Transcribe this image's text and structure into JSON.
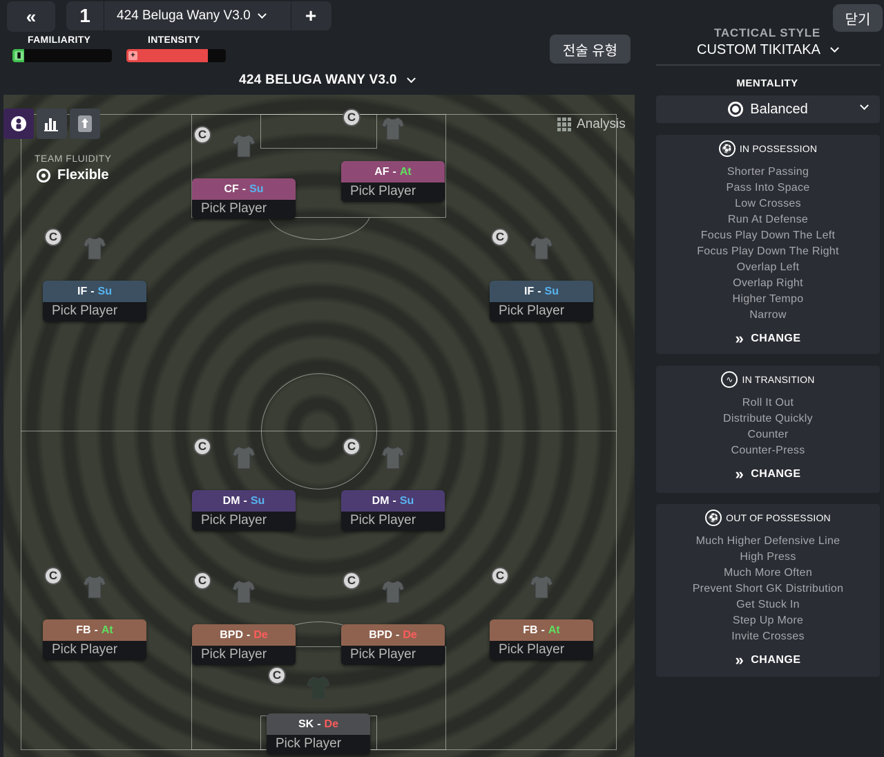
{
  "topbar": {
    "back_icon": "double-chevron-left-icon",
    "tactic_number": "1",
    "tactic_name": "424 Beluga Wany V3.0",
    "add_label": "+",
    "familiarity_label": "FAMILIARITY",
    "familiarity_level": 0.12,
    "intensity_label": "INTENSITY",
    "intensity_level": 0.82,
    "tactical_style_button": "전술 유형",
    "formation_title": "424 BELUGA WANY V3.0"
  },
  "pitch": {
    "analysis_label": "Analysis",
    "team_fluidity_label": "TEAM FLUIDITY",
    "team_fluidity_value": "Flexible",
    "view_tabs": [
      "player-view-icon",
      "stats-bar-icon",
      "arrow-up-icon"
    ],
    "captain_badge": "C",
    "pick_label": "Pick Player",
    "players": [
      {
        "role": "CF",
        "sep": "-",
        "duty": "Su",
        "duty_class": "su",
        "color": "attack"
      },
      {
        "role": "AF",
        "sep": "-",
        "duty": "At",
        "duty_class": "at",
        "color": "attack"
      },
      {
        "role": "IF",
        "sep": "-",
        "duty": "Su",
        "duty_class": "su",
        "color": "wide"
      },
      {
        "role": "IF",
        "sep": "-",
        "duty": "Su",
        "duty_class": "su",
        "color": "wide"
      },
      {
        "role": "DM",
        "sep": "-",
        "duty": "Su",
        "duty_class": "su",
        "color": "mid"
      },
      {
        "role": "DM",
        "sep": "-",
        "duty": "Su",
        "duty_class": "su",
        "color": "mid"
      },
      {
        "role": "FB",
        "sep": "-",
        "duty": "At",
        "duty_class": "at",
        "color": "back"
      },
      {
        "role": "BPD",
        "sep": "-",
        "duty": "De",
        "duty_class": "de",
        "color": "back"
      },
      {
        "role": "BPD",
        "sep": "-",
        "duty": "De",
        "duty_class": "de",
        "color": "back"
      },
      {
        "role": "FB",
        "sep": "-",
        "duty": "At",
        "duty_class": "at",
        "color": "back"
      },
      {
        "role": "SK",
        "sep": "-",
        "duty": "De",
        "duty_class": "de",
        "color": "gk"
      }
    ]
  },
  "sidebar": {
    "close_label": "닫기",
    "tactical_style_label": "TACTICAL STYLE",
    "tactical_style_value": "CUSTOM TIKITAKA",
    "mentality_label": "MENTALITY",
    "mentality_value": "Balanced",
    "change_label": "CHANGE",
    "in_possession": {
      "title": "IN POSSESSION",
      "items": [
        "Shorter Passing",
        "Pass Into Space",
        "Low Crosses",
        "Run At Defense",
        "Focus Play Down The Left",
        "Focus Play Down The Right",
        "Overlap Left",
        "Overlap Right",
        "Higher Tempo",
        "Narrow"
      ]
    },
    "in_transition": {
      "title": "IN TRANSITION",
      "items": [
        "Roll It Out",
        "Distribute Quickly",
        "Counter",
        "Counter-Press"
      ]
    },
    "out_of_possession": {
      "title": "OUT OF POSSESSION",
      "items": [
        "Much Higher Defensive Line",
        "High Press",
        "Much More Often",
        "Prevent Short GK Distribution",
        "Get Stuck In",
        "Step Up More",
        "Invite Crosses"
      ]
    }
  },
  "colors": {
    "attack": "#8e4a74",
    "wide": "#3c5062",
    "mid": "#4d3c72",
    "back": "#8f624f",
    "gk": "#4b4d50",
    "familiarity_fill": "#3fbf4f",
    "intensity_fill": "#e84848"
  }
}
